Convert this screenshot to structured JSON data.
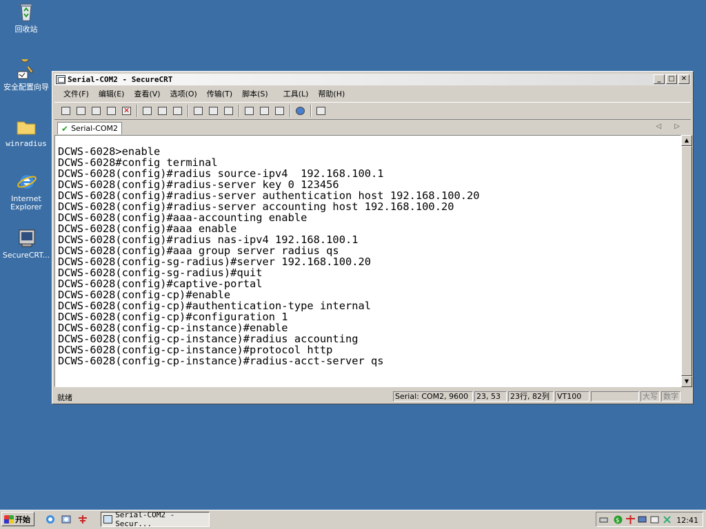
{
  "desktop": {
    "icons": [
      {
        "label": "回收站"
      },
      {
        "label": "安全配置向导"
      },
      {
        "label": "winradius"
      },
      {
        "label": "Internet Explorer"
      },
      {
        "label": "SecureCRT..."
      }
    ]
  },
  "window": {
    "title": "Serial-COM2 - SecureCRT",
    "controls": {
      "minimize": "_",
      "maximize": "□",
      "close": "✕"
    },
    "menu": [
      "文件(F)",
      "编辑(E)",
      "查看(V)",
      "选项(O)",
      "传输(T)",
      "脚本(S)",
      "工具(L)",
      "帮助(H)"
    ],
    "tab": {
      "label": "Serial-COM2"
    },
    "tab_nav": "◁ ▷"
  },
  "terminal": {
    "lines": [
      "DCWS-6028>enable",
      "DCWS-6028#config terminal",
      "DCWS-6028(config)#radius source-ipv4  192.168.100.1",
      "DCWS-6028(config)#radius-server key 0 123456",
      "DCWS-6028(config)#radius-server authentication host 192.168.100.20",
      "DCWS-6028(config)#radius-server accounting host 192.168.100.20",
      "DCWS-6028(config)#aaa-accounting enable",
      "DCWS-6028(config)#aaa enable",
      "DCWS-6028(config)#radius nas-ipv4 192.168.100.1",
      "DCWS-6028(config)#aaa group server radius qs",
      "DCWS-6028(config-sg-radius)#server 192.168.100.20",
      "DCWS-6028(config-sg-radius)#quit",
      "DCWS-6028(config)#captive-portal",
      "DCWS-6028(config-cp)#enable",
      "DCWS-6028(config-cp)#authentication-type internal",
      "DCWS-6028(config-cp)#configuration 1",
      "DCWS-6028(config-cp-instance)#enable",
      "DCWS-6028(config-cp-instance)#radius accounting",
      "DCWS-6028(config-cp-instance)#protocol http",
      "DCWS-6028(config-cp-instance)#radius-acct-server qs"
    ]
  },
  "status": {
    "ready": "就绪",
    "serial": "Serial: COM2, 9600",
    "pos": "23, 53",
    "rowcol": "23行, 82列",
    "emu": "VT100",
    "blank": "",
    "caps": "大写",
    "num": "数字"
  },
  "taskbar": {
    "start": "开始",
    "task": "Serial-COM2 - Secur...",
    "clock": "12:41"
  }
}
